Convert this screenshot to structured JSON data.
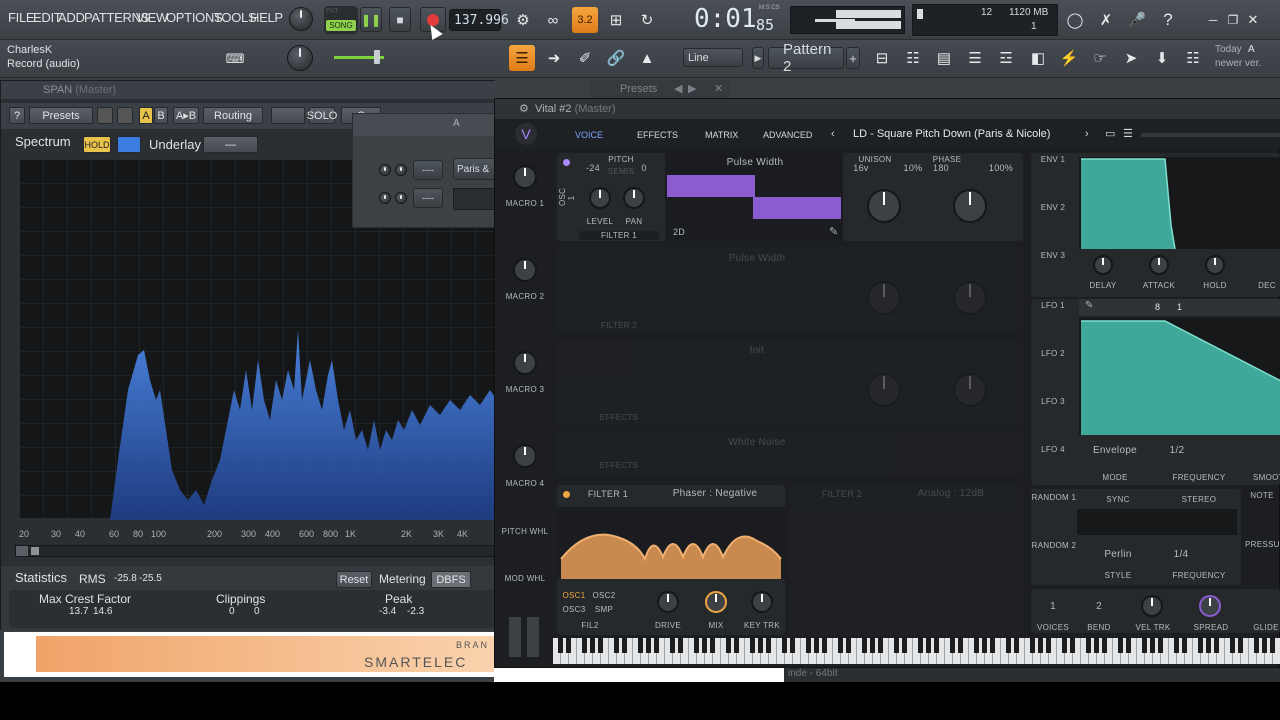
{
  "menu": [
    "FILE",
    "EDIT",
    "ADD",
    "PATTERNS",
    "VIEW",
    "OPTIONS",
    "TOOLS",
    "HELP"
  ],
  "transport": {
    "song_label": "SONG",
    "pat_label": "PAT",
    "tempo": "137.996",
    "time": "0:01",
    "time_sub": "85",
    "time_unit": "M:S:CS"
  },
  "cpu": {
    "value": "12",
    "mem": "1120 MB",
    "count": "1"
  },
  "user": {
    "name": "CharlesK",
    "status": "Record (audio)"
  },
  "toolbar2": {
    "snap": "Line",
    "pattern": "Pattern 2",
    "news_line1": "Today",
    "news_line2": "newer ver.",
    "news_letter": "A"
  },
  "span": {
    "title": "SPAN",
    "title_sub": "(Master)",
    "presets": "Presets",
    "routing": "Routing",
    "solo": "SOLO",
    "spectrum": "Spectrum",
    "hold": "HOLD",
    "underlay": "Underlay",
    "underlay_val": "—",
    "a": "A",
    "b": "B",
    "ab": "A▸B",
    "help": "?",
    "c_label": "C",
    "freq_labels": [
      "20",
      "30",
      "40",
      "60",
      "80",
      "100",
      "200",
      "300",
      "400",
      "600",
      "800",
      "1K",
      "2K",
      "3K",
      "4K"
    ],
    "statistics": "Statistics",
    "rms": "RMS",
    "rms_l": "-25.8",
    "rms_r": "-25.5",
    "reset": "Reset",
    "metering": "Metering",
    "dbfs": "DBFS",
    "crest": "Max Crest Factor",
    "crest_l": "13.7",
    "crest_r": "14.6",
    "clip": "Clippings",
    "clip_l": "0",
    "clip_r": "0",
    "peak": "Peak",
    "peak_l": "-3.4",
    "peak_r": "-2.3"
  },
  "presetsTab": "Presets",
  "float": {
    "label": "Paris &",
    "field1": "----",
    "field2": "----"
  },
  "vital": {
    "title": "Vital #2",
    "title_sub": "(Master)",
    "tabs": [
      "VOICE",
      "EFFECTS",
      "MATRIX",
      "ADVANCED"
    ],
    "preset": "LD - Square Pitch Down (Paris & Nicole)",
    "osc": {
      "pitch": "PITCH",
      "semis": "SEMIS",
      "pitch_l": "-24",
      "pitch_r": "0",
      "wave": "Pulse Width",
      "level": "LEVEL",
      "pan": "PAN",
      "dest": "FILTER 1",
      "dim": "2D",
      "unison": "UNISON",
      "voices": "16v",
      "detune": "10%",
      "phase": "PHASE",
      "phase_v": "180",
      "phase_pct": "100%",
      "osc1": "OSC 1"
    },
    "osc_dim": {
      "wave2": "Pulse Width",
      "wave3": "Init",
      "noise": "White Noise",
      "fx": "EFFECTS",
      "fil2": "FILTER 2"
    },
    "macros": [
      "MACRO 1",
      "MACRO 2",
      "MACRO 3",
      "MACRO 4"
    ],
    "pitch_whl": "PITCH WHL",
    "mod_whl": "MOD WHL",
    "filter": {
      "label": "FILTER 1",
      "type": "Phaser : Negative",
      "osc1": "OSC1",
      "osc2": "OSC2",
      "osc3": "OSC3",
      "smp": "SMP",
      "fil2": "FIL2",
      "drive": "DRIVE",
      "mix": "MIX",
      "keytrk": "KEY TRK",
      "f2": "FILTER 2",
      "analog": "Analog : 12dB"
    },
    "env": {
      "labels": [
        "ENV 1",
        "ENV 2",
        "ENV 3"
      ],
      "delay": "DELAY",
      "attack": "ATTACK",
      "hold": "HOLD",
      "decay": "DEC"
    },
    "lfo": {
      "labels": [
        "LFO 1",
        "LFO 2",
        "LFO 3",
        "LFO 4"
      ],
      "grid": "8",
      "grid2": "1",
      "mode": "Envelope",
      "mode_label": "MODE",
      "freq": "1/2",
      "freq_label": "FREQUENCY",
      "smooth": "SMOOT"
    },
    "random": {
      "labels": [
        "RANDOM 1",
        "RANDOM 2"
      ],
      "sync": "SYNC",
      "stereo": "STEREO",
      "style": "Perlin",
      "style_label": "STYLE",
      "freq": "1/4",
      "freq_label": "FREQUENCY",
      "note": "NOTE",
      "pressure": "PRESSUR"
    },
    "voice": {
      "voices": "1",
      "voices_label": "VOICES",
      "bend": "2",
      "bend_label": "BEND",
      "veltrk": "VEL TRK",
      "spread": "SPREAD",
      "glide": "GLIDE"
    }
  },
  "program": {
    "brand": "SMARTELEC",
    "brand_small": "BRAN",
    "bit": "inde - 64bit"
  }
}
